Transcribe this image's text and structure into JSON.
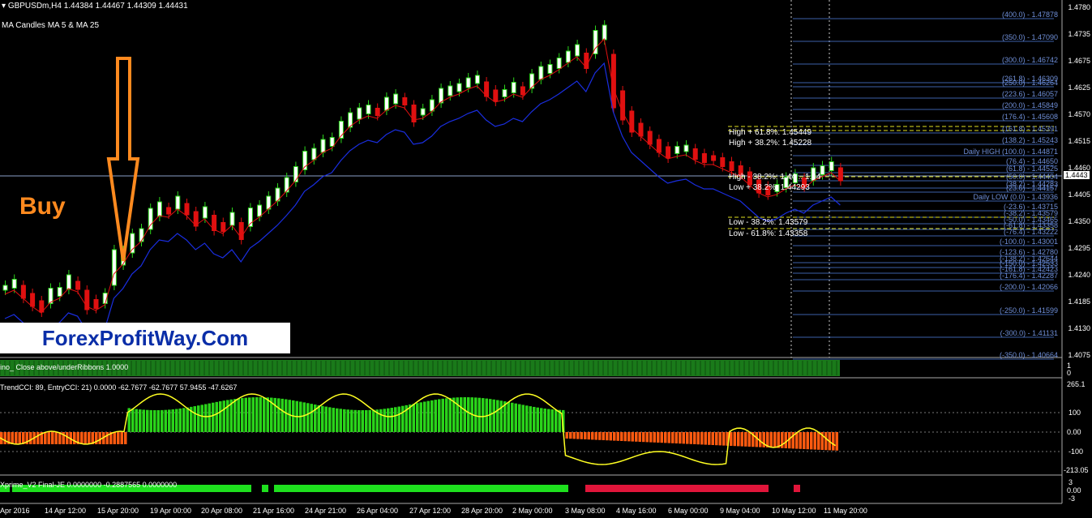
{
  "header": {
    "symbol_info": "GBPUSDm,H4  1.44384 1.44467 1.44309 1.44431",
    "indicator_info": "MA Candles  MA 5  &  MA 25"
  },
  "annotations": {
    "buy": "Buy",
    "watermark": "ForexProfitWay.Com"
  },
  "price_axis": {
    "ticks": [
      "1.4780",
      "1.4735",
      "1.4675",
      "1.4625",
      "1.4570",
      "1.4515",
      "1.4460",
      "1.4405",
      "1.4350",
      "1.4295",
      "1.4240",
      "1.4185",
      "1.4130",
      "1.4075"
    ],
    "current_price": "1.4443"
  },
  "fib_levels": [
    "(400.0) - 1.47878",
    "(350.0) - 1.47090",
    "(300.0) - 1.46742",
    "(261.8) - 1.46309",
    "(250.0) - 1.46264",
    "(223.6) - 1.46057",
    "(200.0) - 1.45849",
    "(176.4) - 1.45608",
    "(161.8) - 1.45391",
    "(138.2) - 1.45243",
    "Daily HIGH (100.0) - 1.44871",
    "(76.4) - 1.44650",
    "(61.8) - 1.44525",
    "(50.0) - 1.44404",
    "(38.2) - 1.44283",
    "(23.6) - 1.44157",
    "Daily LOW (0.0) - 1.43936",
    "(-23.6) - 1.43715",
    "(-38.2) - 1.43579",
    "(-50.0) - 1.43465",
    "(-61.8) - 1.43358",
    "(-76.4) - 1.43222",
    "(-100.0) - 1.43001",
    "(-123.6) - 1.42780",
    "(-138.2) - 1.42644",
    "(-150.0) - 1.42533",
    "(-161.8) - 1.42423",
    "(-176.4) - 1.42287",
    "(-200.0) - 1.42066",
    "(-250.0) - 1.41599",
    "(-300.0) - 1.41131",
    "(-350.0) - 1.40664"
  ],
  "level_texts": {
    "high618": "High + 61.8%: 1.45449",
    "high382": "High + 38.2%: 1.45228",
    "mid_high": "High - 38.2%: 1.44 .. 1.44",
    "mid_low": "Low + 38.2%: 1.44293",
    "low382": "Low - 38.2%: 1.43579",
    "low618": "Low - 61.8%: 1.43358"
  },
  "panel1": {
    "title": "ino_ Close above/underRibbons 1.0000",
    "scale": [
      "1",
      "0"
    ]
  },
  "panel2": {
    "title": "TrendCCI: 89, EntryCCI: 21)  0.0000 -62.7677 -62.7677 57.9455 -47.6267",
    "scale": [
      "265.1",
      "100",
      "0.00",
      "-100",
      "-213.05"
    ]
  },
  "panel3": {
    "title": "Xprime_V2 Final-JE 0.0000000 -0.2887565 0.0000000",
    "scale": [
      "3",
      "0.00",
      "-3"
    ]
  },
  "time_axis": [
    "Apr 2016",
    "14 Apr 12:00",
    "15 Apr 20:00",
    "19 Apr 00:00",
    "20 Apr 08:00",
    "21 Apr 16:00",
    "24 Apr 21:00",
    "26 Apr 04:00",
    "27 Apr 12:00",
    "28 Apr 20:00",
    "2 May 00:00",
    "3 May 08:00",
    "4 May 16:00",
    "6 May 00:00",
    "9 May 04:00",
    "10 May 12:00",
    "11 May 20:00"
  ],
  "colors": {
    "bull": "#2ad41a",
    "bear": "#e01010",
    "ma_fast": "#e01010",
    "ma_slow": "#1a2ee0",
    "cci": "#ffff22",
    "fib": "#4f7fe0"
  }
}
